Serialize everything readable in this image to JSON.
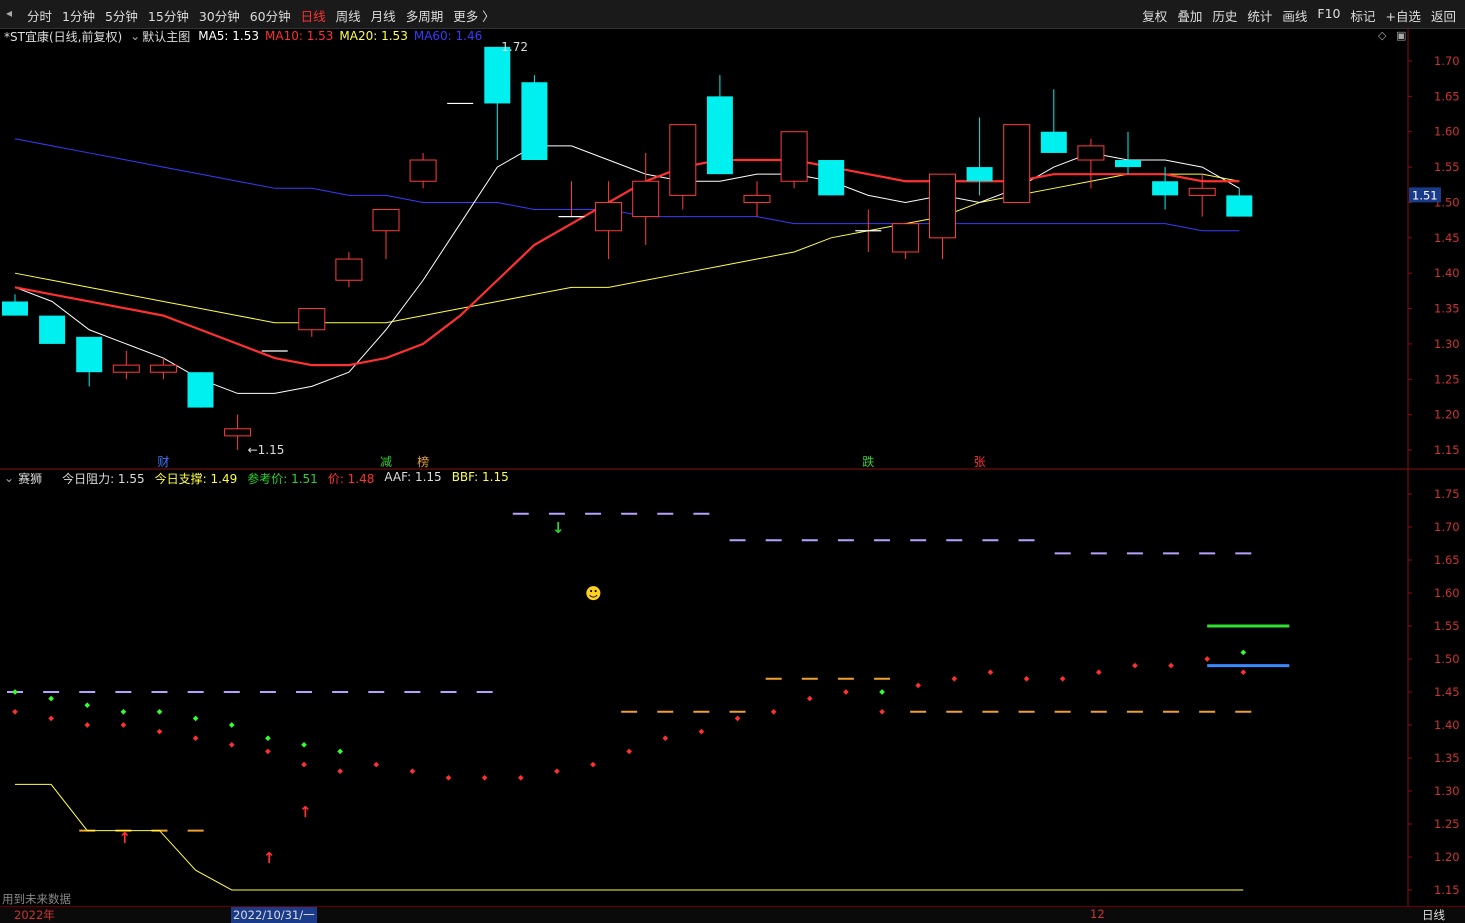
{
  "toolbar": {
    "back_icon": "prev-arrow-icon",
    "tabs": [
      "分时",
      "1分钟",
      "5分钟",
      "15分钟",
      "30分钟",
      "60分钟",
      "日线",
      "周线",
      "月线",
      "多周期",
      "更多 〉"
    ],
    "active_tab": "日线",
    "right_tools": [
      "复权",
      "叠加",
      "历史",
      "统计",
      "画线",
      "F10",
      "标记",
      "+自选",
      "返回"
    ]
  },
  "main_legend": {
    "stock_title": "*ST宜康(日线,前复权)",
    "template": "默认主图",
    "ma": [
      {
        "label": "MA5: 1.53",
        "color": "#ffffff"
      },
      {
        "label": "MA10: 1.53",
        "color": "#ff3030"
      },
      {
        "label": "MA20: 1.53",
        "color": "#ffff40"
      },
      {
        "label": "MA60: 1.46",
        "color": "#3a3aff"
      }
    ]
  },
  "main_chart": {
    "y_ticks": [
      "1.70",
      "1.65",
      "1.60",
      "1.55",
      "1.50",
      "1.45",
      "1.40",
      "1.35",
      "1.30",
      "1.25",
      "1.20",
      "1.15"
    ],
    "current_price": "1.51",
    "high_label": "1.72",
    "low_label": "←1.15",
    "event_tags": [
      {
        "text": "财",
        "color": "#3a78ff"
      },
      {
        "text": "减",
        "color": "#30d030"
      },
      {
        "text": "榜",
        "color": "#e8a030"
      },
      {
        "text": "跌",
        "color": "#30d030"
      },
      {
        "text": "张",
        "color": "#ff3030"
      }
    ],
    "candles": [
      {
        "o": 1.36,
        "h": 1.37,
        "l": 1.34,
        "c": 1.34
      },
      {
        "o": 1.34,
        "h": 1.34,
        "l": 1.3,
        "c": 1.3
      },
      {
        "o": 1.31,
        "h": 1.31,
        "l": 1.24,
        "c": 1.26
      },
      {
        "o": 1.26,
        "h": 1.29,
        "l": 1.25,
        "c": 1.27
      },
      {
        "o": 1.26,
        "h": 1.28,
        "l": 1.25,
        "c": 1.27
      },
      {
        "o": 1.26,
        "h": 1.26,
        "l": 1.21,
        "c": 1.21
      },
      {
        "o": 1.17,
        "h": 1.2,
        "l": 1.15,
        "c": 1.18
      },
      {
        "o": 1.29,
        "h": 1.29,
        "l": 1.29,
        "c": 1.29
      },
      {
        "o": 1.32,
        "h": 1.35,
        "l": 1.31,
        "c": 1.35
      },
      {
        "o": 1.39,
        "h": 1.43,
        "l": 1.38,
        "c": 1.42
      },
      {
        "o": 1.46,
        "h": 1.49,
        "l": 1.42,
        "c": 1.49
      },
      {
        "o": 1.53,
        "h": 1.57,
        "l": 1.52,
        "c": 1.56
      },
      {
        "o": 1.64,
        "h": 1.64,
        "l": 1.64,
        "c": 1.64
      },
      {
        "o": 1.72,
        "h": 1.72,
        "l": 1.56,
        "c": 1.64
      },
      {
        "o": 1.67,
        "h": 1.68,
        "l": 1.56,
        "c": 1.56
      },
      {
        "o": 1.48,
        "h": 1.53,
        "l": 1.48,
        "c": 1.48
      },
      {
        "o": 1.46,
        "h": 1.53,
        "l": 1.42,
        "c": 1.5
      },
      {
        "o": 1.48,
        "h": 1.57,
        "l": 1.44,
        "c": 1.53
      },
      {
        "o": 1.51,
        "h": 1.56,
        "l": 1.49,
        "c": 1.61
      },
      {
        "o": 1.65,
        "h": 1.68,
        "l": 1.54,
        "c": 1.54
      },
      {
        "o": 1.5,
        "h": 1.53,
        "l": 1.48,
        "c": 1.51
      },
      {
        "o": 1.53,
        "h": 1.6,
        "l": 1.52,
        "c": 1.6
      },
      {
        "o": 1.56,
        "h": 1.56,
        "l": 1.51,
        "c": 1.51
      },
      {
        "o": 1.46,
        "h": 1.49,
        "l": 1.43,
        "c": 1.46
      },
      {
        "o": 1.43,
        "h": 1.47,
        "l": 1.42,
        "c": 1.47
      },
      {
        "o": 1.45,
        "h": 1.53,
        "l": 1.42,
        "c": 1.54
      },
      {
        "o": 1.55,
        "h": 1.62,
        "l": 1.51,
        "c": 1.53
      },
      {
        "o": 1.5,
        "h": 1.61,
        "l": 1.5,
        "c": 1.61
      },
      {
        "o": 1.6,
        "h": 1.66,
        "l": 1.57,
        "c": 1.57
      },
      {
        "o": 1.56,
        "h": 1.59,
        "l": 1.52,
        "c": 1.58
      },
      {
        "o": 1.56,
        "h": 1.6,
        "l": 1.54,
        "c": 1.55
      },
      {
        "o": 1.53,
        "h": 1.55,
        "l": 1.49,
        "c": 1.51
      },
      {
        "o": 1.51,
        "h": 1.54,
        "l": 1.48,
        "c": 1.52
      },
      {
        "o": 1.51,
        "h": 1.52,
        "l": 1.48,
        "c": 1.48
      }
    ],
    "ma5": [
      1.38,
      1.36,
      1.32,
      1.3,
      1.28,
      1.25,
      1.23,
      1.23,
      1.24,
      1.26,
      1.32,
      1.39,
      1.47,
      1.55,
      1.58,
      1.58,
      1.56,
      1.54,
      1.53,
      1.53,
      1.54,
      1.54,
      1.53,
      1.51,
      1.5,
      1.51,
      1.5,
      1.52,
      1.55,
      1.57,
      1.56,
      1.56,
      1.55,
      1.52
    ],
    "ma10": [
      1.38,
      1.37,
      1.36,
      1.35,
      1.34,
      1.32,
      1.3,
      1.28,
      1.27,
      1.27,
      1.28,
      1.3,
      1.34,
      1.39,
      1.44,
      1.47,
      1.5,
      1.53,
      1.55,
      1.56,
      1.56,
      1.56,
      1.55,
      1.54,
      1.53,
      1.53,
      1.53,
      1.53,
      1.54,
      1.54,
      1.54,
      1.54,
      1.53,
      1.53
    ],
    "ma20": [
      1.4,
      1.39,
      1.38,
      1.37,
      1.36,
      1.35,
      1.34,
      1.33,
      1.33,
      1.33,
      1.33,
      1.34,
      1.35,
      1.36,
      1.37,
      1.38,
      1.38,
      1.39,
      1.4,
      1.41,
      1.42,
      1.43,
      1.45,
      1.46,
      1.47,
      1.48,
      1.5,
      1.51,
      1.52,
      1.53,
      1.54,
      1.54,
      1.54,
      1.53
    ],
    "ma60": [
      1.59,
      1.58,
      1.57,
      1.56,
      1.55,
      1.54,
      1.53,
      1.52,
      1.52,
      1.51,
      1.51,
      1.5,
      1.5,
      1.5,
      1.49,
      1.49,
      1.49,
      1.48,
      1.48,
      1.48,
      1.48,
      1.47,
      1.47,
      1.47,
      1.47,
      1.47,
      1.47,
      1.47,
      1.47,
      1.47,
      1.47,
      1.47,
      1.46,
      1.46
    ]
  },
  "sub_legend": {
    "indicator": "赛狮",
    "items": [
      {
        "label": "今日阻力: 1.55",
        "color": "#dddddd"
      },
      {
        "label": "今日支撑: 1.49",
        "color": "#ffff40"
      },
      {
        "label": "参考价: 1.51",
        "color": "#30d030"
      },
      {
        "label": "价: 1.48",
        "color": "#ff3030"
      },
      {
        "label": "AAF: 1.15",
        "color": "#dddddd"
      },
      {
        "label": "BBF: 1.15",
        "color": "#ffff40"
      }
    ]
  },
  "sub_chart": {
    "y_ticks": [
      "1.75",
      "1.70",
      "1.65",
      "1.60",
      "1.55",
      "1.50",
      "1.45",
      "1.40",
      "1.35",
      "1.30",
      "1.25",
      "1.20",
      "1.15"
    ],
    "red_dots": [
      1.42,
      1.41,
      1.4,
      1.4,
      1.39,
      1.38,
      1.37,
      1.36,
      1.34,
      1.33,
      1.34,
      1.33,
      1.32,
      1.32,
      1.32,
      1.33,
      1.34,
      1.36,
      1.38,
      1.39,
      1.41,
      1.42,
      1.44,
      1.45,
      1.42,
      1.46,
      1.47,
      1.48,
      1.47,
      1.47,
      1.48,
      1.49,
      1.49,
      1.5,
      1.48
    ],
    "green_dots": [
      1.45,
      1.44,
      1.43,
      1.42,
      1.42,
      1.41,
      1.4,
      1.38,
      1.37,
      1.36,
      null,
      null,
      null,
      null,
      null,
      null,
      null,
      null,
      null,
      null,
      null,
      null,
      null,
      null,
      1.45,
      null,
      null,
      null,
      null,
      null,
      null,
      null,
      null,
      null,
      1.51
    ],
    "purple_segments": [
      {
        "from": 0,
        "to": 13,
        "v": 1.45
      },
      {
        "from": 14,
        "to": 19,
        "v": 1.72
      },
      {
        "from": 20,
        "to": 28,
        "v": 1.68
      },
      {
        "from": 29,
        "to": 34,
        "v": 1.66
      }
    ],
    "orange_segments": [
      {
        "from": 2,
        "to": 5,
        "v": 1.24
      },
      {
        "from": 17,
        "to": 20,
        "v": 1.42
      },
      {
        "from": 21,
        "to": 24,
        "v": 1.47
      },
      {
        "from": 25,
        "to": 34,
        "v": 1.42
      }
    ],
    "yellow_line": [
      1.31,
      1.31,
      1.24,
      1.24,
      1.24,
      1.18,
      1.15,
      1.15,
      1.15,
      1.15,
      1.15,
      1.15,
      1.15,
      1.15,
      1.15,
      1.15,
      1.15
    ],
    "green_bar": 1.55,
    "blue_bar": 1.49,
    "smiley": "☻",
    "up_arrow_icon": "↑",
    "down_arrow_icon": "↓",
    "footnote": "用到未来数据"
  },
  "bottom": {
    "dates": [
      "2022年",
      "2022/10/31/一",
      "12"
    ],
    "period": "日线"
  }
}
